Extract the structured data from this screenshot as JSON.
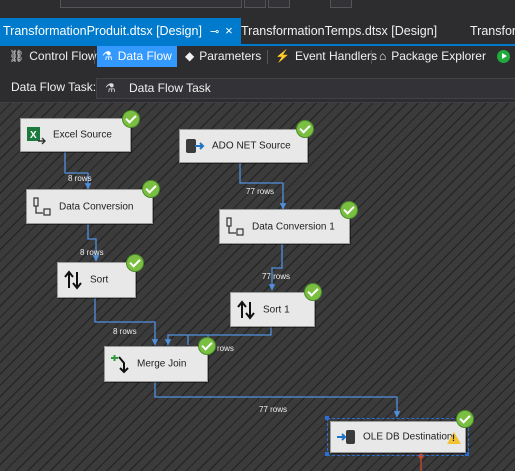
{
  "window": {
    "tabs": [
      {
        "label": "TransformationProduit.dtsx [Design]",
        "pin": "⊸",
        "close": "×",
        "active": true
      },
      {
        "label": "TransformationTemps.dtsx [Design]",
        "active": false
      },
      {
        "label": "Transfor",
        "active": false
      }
    ]
  },
  "toolbar": {
    "items": [
      {
        "label": "Control Flow",
        "icon": "control-flow-icon"
      },
      {
        "label": "Data Flow",
        "icon": "data-flow-icon",
        "active": true
      },
      {
        "label": "Parameters",
        "icon": "parameters-icon"
      },
      {
        "label": "Event Handlers",
        "icon": "event-handlers-icon"
      },
      {
        "label": "Package Explorer",
        "icon": "package-explorer-icon"
      }
    ]
  },
  "task": {
    "label": "Data Flow Task:",
    "selected": "Data Flow Task"
  },
  "canvas": {
    "components": [
      {
        "id": "excel",
        "label": "Excel Source",
        "icon": "excel-icon",
        "status": "success"
      },
      {
        "id": "ado",
        "label": "ADO NET Source",
        "icon": "ado-net-icon",
        "status": "success"
      },
      {
        "id": "dc",
        "label": "Data Conversion",
        "icon": "data-conversion-icon",
        "status": "success"
      },
      {
        "id": "dc1",
        "label": "Data Conversion 1",
        "icon": "data-conversion-icon",
        "status": "success"
      },
      {
        "id": "sort",
        "label": "Sort",
        "icon": "sort-icon",
        "status": "success"
      },
      {
        "id": "sort1",
        "label": "Sort 1",
        "icon": "sort-icon",
        "status": "success"
      },
      {
        "id": "mj",
        "label": "Merge Join",
        "icon": "merge-join-icon",
        "status": "success"
      },
      {
        "id": "ole",
        "label": "OLE DB Destination",
        "icon": "ole-db-icon",
        "status": "success",
        "warning": "!"
      }
    ],
    "row_labels": [
      "8 rows",
      "77 rows",
      "8 rows",
      "77 rows",
      "8 rows",
      "rows",
      "77 rows"
    ]
  },
  "colors": {
    "accent": "#007acc",
    "success": "#7bbf42",
    "warning": "#f2c230",
    "link": "#4f8fdc"
  }
}
